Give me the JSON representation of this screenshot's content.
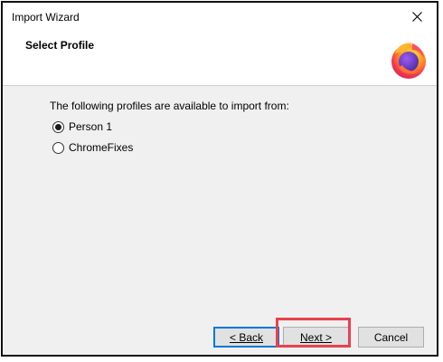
{
  "window": {
    "title": "Import Wizard"
  },
  "icons": {
    "close": "close-icon",
    "logo": "firefox-logo"
  },
  "header": {
    "title": "Select Profile"
  },
  "content": {
    "instruction": "The following profiles are available to import from:",
    "profiles": [
      {
        "label": "Person 1",
        "selected": true
      },
      {
        "label": "ChromeFixes",
        "selected": false
      }
    ]
  },
  "buttons": {
    "back": "< Back",
    "next": "Next >",
    "cancel": "Cancel"
  },
  "colors": {
    "highlight": "#e8414f",
    "focus_border": "#0078d7"
  }
}
